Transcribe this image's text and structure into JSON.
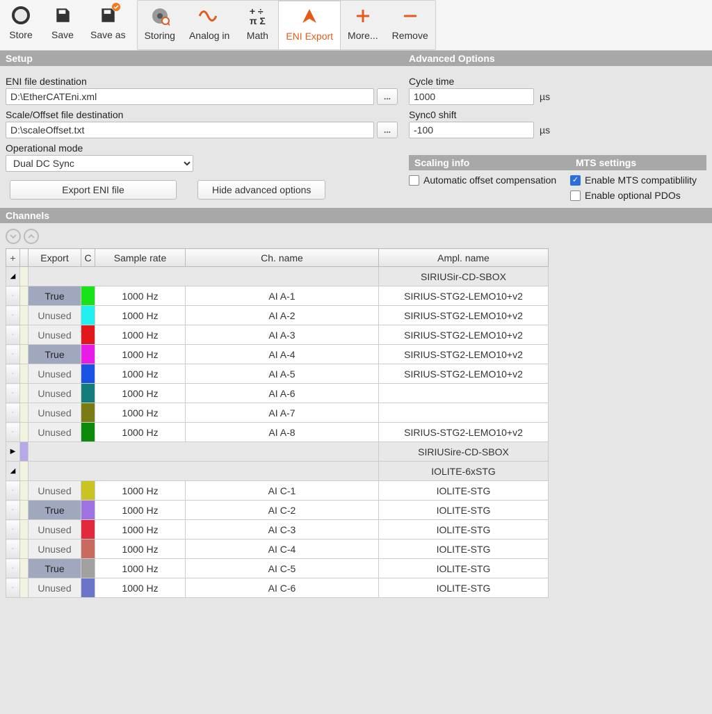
{
  "toolbar": {
    "store": "Store",
    "save": "Save",
    "save_as": "Save as",
    "storing": "Storing",
    "analog_in": "Analog in",
    "math": "Math",
    "eni_export": "ENI Export",
    "more": "More...",
    "remove": "Remove"
  },
  "sections": {
    "setup": "Setup",
    "advanced": "Advanced Options",
    "scaling": "Scaling info",
    "mts": "MTS settings",
    "channels": "Channels"
  },
  "setup": {
    "eni_dest_label": "ENI file destination",
    "eni_dest_value": "D:\\EtherCATEni.xml",
    "scale_dest_label": "Scale/Offset file destination",
    "scale_dest_value": "D:\\scaleOffset.txt",
    "op_mode_label": "Operational mode",
    "op_mode_value": "Dual DC Sync",
    "browse": "...",
    "export_btn": "Export ENI file",
    "hide_btn": "Hide advanced options"
  },
  "advanced": {
    "cycle_time_label": "Cycle time",
    "cycle_time_value": "1000",
    "sync0_label": "Sync0 shift",
    "sync0_value": "-100",
    "unit_us": "µs",
    "auto_offset": "Automatic offset compensation",
    "mts_compat": "Enable MTS compatiblility",
    "opt_pdo": "Enable optional PDOs"
  },
  "grid": {
    "headers": {
      "plus": "+",
      "export": "Export",
      "c": "C",
      "rate": "Sample rate",
      "name": "Ch. name",
      "ampl": "Ampl. name"
    },
    "groups": [
      {
        "expander": "◢",
        "ampl": "SIRIUSir-CD-SBOX",
        "rows": [
          {
            "export": "True",
            "color": "#18e318",
            "rate": "1000 Hz",
            "name": "AI A-1",
            "ampl": "SIRIUS-STG2-LEMO10+v2"
          },
          {
            "export": "Unused",
            "color": "#22f0f0",
            "rate": "1000 Hz",
            "name": "AI A-2",
            "ampl": "SIRIUS-STG2-LEMO10+v2"
          },
          {
            "export": "Unused",
            "color": "#e3171a",
            "rate": "1000 Hz",
            "name": "AI A-3",
            "ampl": "SIRIUS-STG2-LEMO10+v2"
          },
          {
            "export": "True",
            "color": "#e81be8",
            "rate": "1000 Hz",
            "name": "AI A-4",
            "ampl": "SIRIUS-STG2-LEMO10+v2"
          },
          {
            "export": "Unused",
            "color": "#1a53e3",
            "rate": "1000 Hz",
            "name": "AI A-5",
            "ampl": "SIRIUS-STG2-LEMO10+v2"
          },
          {
            "export": "Unused",
            "color": "#167b7b",
            "rate": "1000 Hz",
            "name": "AI A-6",
            "ampl": ""
          },
          {
            "export": "Unused",
            "color": "#7b7b16",
            "rate": "1000 Hz",
            "name": "AI A-7",
            "ampl": ""
          },
          {
            "export": "Unused",
            "color": "#0b8a0b",
            "rate": "1000 Hz",
            "name": "AI A-8",
            "ampl": "SIRIUS-STG2-LEMO10+v2"
          }
        ]
      },
      {
        "expander": "▶",
        "mark": "#b8a8e8",
        "ampl": "SIRIUSire-CD-SBOX",
        "rows": []
      },
      {
        "expander": "◢",
        "ampl": "IOLITE-6xSTG",
        "rows": [
          {
            "export": "Unused",
            "color": "#c9c421",
            "rate": "1000 Hz",
            "name": "AI C-1",
            "ampl": "IOLITE-STG"
          },
          {
            "export": "True",
            "color": "#a073e3",
            "rate": "1000 Hz",
            "name": "AI C-2",
            "ampl": "IOLITE-STG"
          },
          {
            "export": "Unused",
            "color": "#e3283e",
            "rate": "1000 Hz",
            "name": "AI C-3",
            "ampl": "IOLITE-STG"
          },
          {
            "export": "Unused",
            "color": "#c96a5e",
            "rate": "1000 Hz",
            "name": "AI C-4",
            "ampl": "IOLITE-STG"
          },
          {
            "export": "True",
            "color": "#a0a0a0",
            "rate": "1000 Hz",
            "name": "AI C-5",
            "ampl": "IOLITE-STG"
          },
          {
            "export": "Unused",
            "color": "#6a75c9",
            "rate": "1000 Hz",
            "name": "AI C-6",
            "ampl": "IOLITE-STG"
          }
        ]
      }
    ]
  }
}
